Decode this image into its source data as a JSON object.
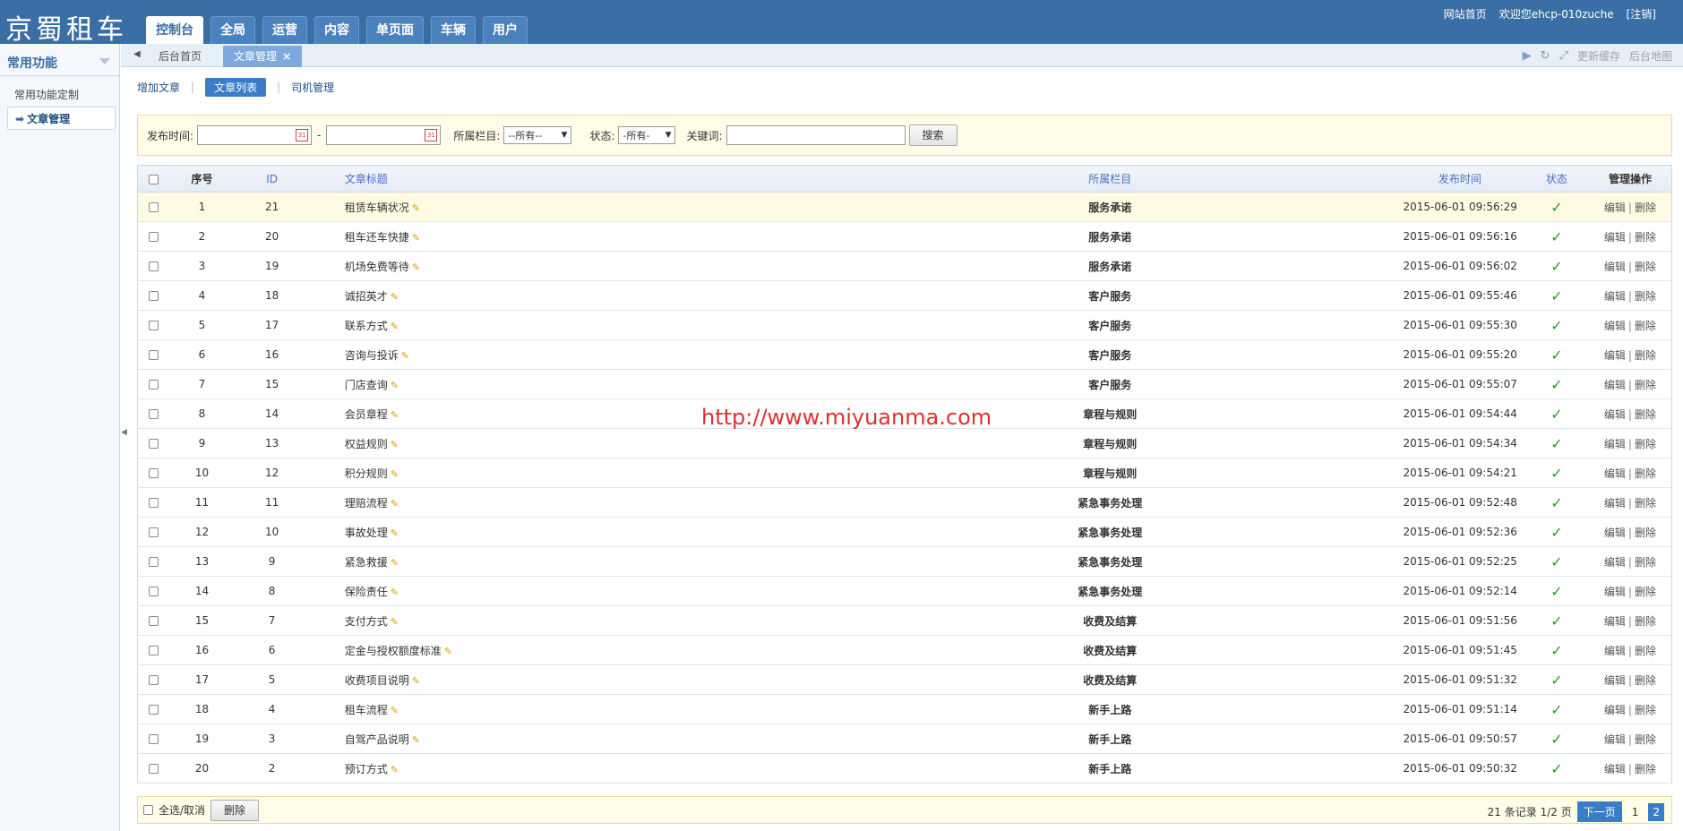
{
  "app": {
    "logo": "京蜀租车"
  },
  "topnav": [
    {
      "label": "控制台",
      "active": true
    },
    {
      "label": "全局"
    },
    {
      "label": "运营"
    },
    {
      "label": "内容"
    },
    {
      "label": "单页面"
    },
    {
      "label": "车辆"
    },
    {
      "label": "用户"
    }
  ],
  "toplinks": {
    "home": "网站首页",
    "welcome": "欢迎您ehcp-010zuche",
    "logout": "[注销]"
  },
  "sidebar": {
    "title": "常用功能",
    "items": [
      {
        "label": "常用功能定制"
      },
      {
        "label": "文章管理",
        "active": true,
        "arrow": "➡"
      }
    ]
  },
  "tabs": {
    "home": "后台首页",
    "current": "文章管理",
    "close": "×",
    "refresh_cache": "更新缓存",
    "site_map": "后台地图"
  },
  "subnav": {
    "add": "增加文章",
    "list": "文章列表",
    "driver": "司机管理"
  },
  "filter": {
    "publish_time": "发布时间:",
    "dash": "-",
    "category": "所属栏目:",
    "category_value": "--所有--",
    "status": "状态:",
    "status_value": "-所有-",
    "keyword": "关键词:",
    "search": "搜索",
    "cal_icon": "31"
  },
  "table": {
    "headers": {
      "no": "序号",
      "id": "ID",
      "title": "文章标题",
      "category": "所属栏目",
      "time": "发布时间",
      "status": "状态",
      "ops": "管理操作"
    },
    "edit": "编辑",
    "sep": "|",
    "delete": "删除",
    "tick": "✓",
    "rows": [
      {
        "no": "1",
        "id": "21",
        "title": "租赁车辆状况",
        "category": "服务承诺",
        "time": "2015-06-01 09:56:29"
      },
      {
        "no": "2",
        "id": "20",
        "title": "租车还车快捷",
        "category": "服务承诺",
        "time": "2015-06-01 09:56:16"
      },
      {
        "no": "3",
        "id": "19",
        "title": "机场免费等待",
        "category": "服务承诺",
        "time": "2015-06-01 09:56:02"
      },
      {
        "no": "4",
        "id": "18",
        "title": "诚招英才",
        "category": "客户服务",
        "time": "2015-06-01 09:55:46"
      },
      {
        "no": "5",
        "id": "17",
        "title": "联系方式",
        "category": "客户服务",
        "time": "2015-06-01 09:55:30"
      },
      {
        "no": "6",
        "id": "16",
        "title": "咨询与投诉",
        "category": "客户服务",
        "time": "2015-06-01 09:55:20"
      },
      {
        "no": "7",
        "id": "15",
        "title": "门店查询",
        "category": "客户服务",
        "time": "2015-06-01 09:55:07"
      },
      {
        "no": "8",
        "id": "14",
        "title": "会员章程",
        "category": "章程与规则",
        "time": "2015-06-01 09:54:44"
      },
      {
        "no": "9",
        "id": "13",
        "title": "权益规则",
        "category": "章程与规则",
        "time": "2015-06-01 09:54:34"
      },
      {
        "no": "10",
        "id": "12",
        "title": "积分规则",
        "category": "章程与规则",
        "time": "2015-06-01 09:54:21"
      },
      {
        "no": "11",
        "id": "11",
        "title": "理赔流程",
        "category": "紧急事务处理",
        "time": "2015-06-01 09:52:48"
      },
      {
        "no": "12",
        "id": "10",
        "title": "事故处理",
        "category": "紧急事务处理",
        "time": "2015-06-01 09:52:36"
      },
      {
        "no": "13",
        "id": "9",
        "title": "紧急救援",
        "category": "紧急事务处理",
        "time": "2015-06-01 09:52:25"
      },
      {
        "no": "14",
        "id": "8",
        "title": "保险责任",
        "category": "紧急事务处理",
        "time": "2015-06-01 09:52:14"
      },
      {
        "no": "15",
        "id": "7",
        "title": "支付方式",
        "category": "收费及结算",
        "time": "2015-06-01 09:51:56"
      },
      {
        "no": "16",
        "id": "6",
        "title": "定金与授权额度标准",
        "category": "收费及结算",
        "time": "2015-06-01 09:51:45"
      },
      {
        "no": "17",
        "id": "5",
        "title": "收费项目说明",
        "category": "收费及结算",
        "time": "2015-06-01 09:51:32"
      },
      {
        "no": "18",
        "id": "4",
        "title": "租车流程",
        "category": "新手上路",
        "time": "2015-06-01 09:51:14"
      },
      {
        "no": "19",
        "id": "3",
        "title": "自驾产品说明",
        "category": "新手上路",
        "time": "2015-06-01 09:50:57"
      },
      {
        "no": "20",
        "id": "2",
        "title": "预订方式",
        "category": "新手上路",
        "time": "2015-06-01 09:50:32"
      }
    ]
  },
  "footer": {
    "select_all": "全选/取消",
    "delete": "删除",
    "records": "21 条记录 1/2 页",
    "next": "下一页",
    "page1": "1",
    "page2": "2"
  },
  "watermark": "http://www.miyuanma.com",
  "icons": {
    "pencil": "pencil-icon",
    "check": "check-icon",
    "calendar": "calendar-icon",
    "refresh": "refresh-icon",
    "fullscreen": "fullscreen-icon"
  },
  "colors": {
    "header": "#3a6ea5",
    "accent": "#3a7cc7",
    "check": "#2a9a2a"
  }
}
